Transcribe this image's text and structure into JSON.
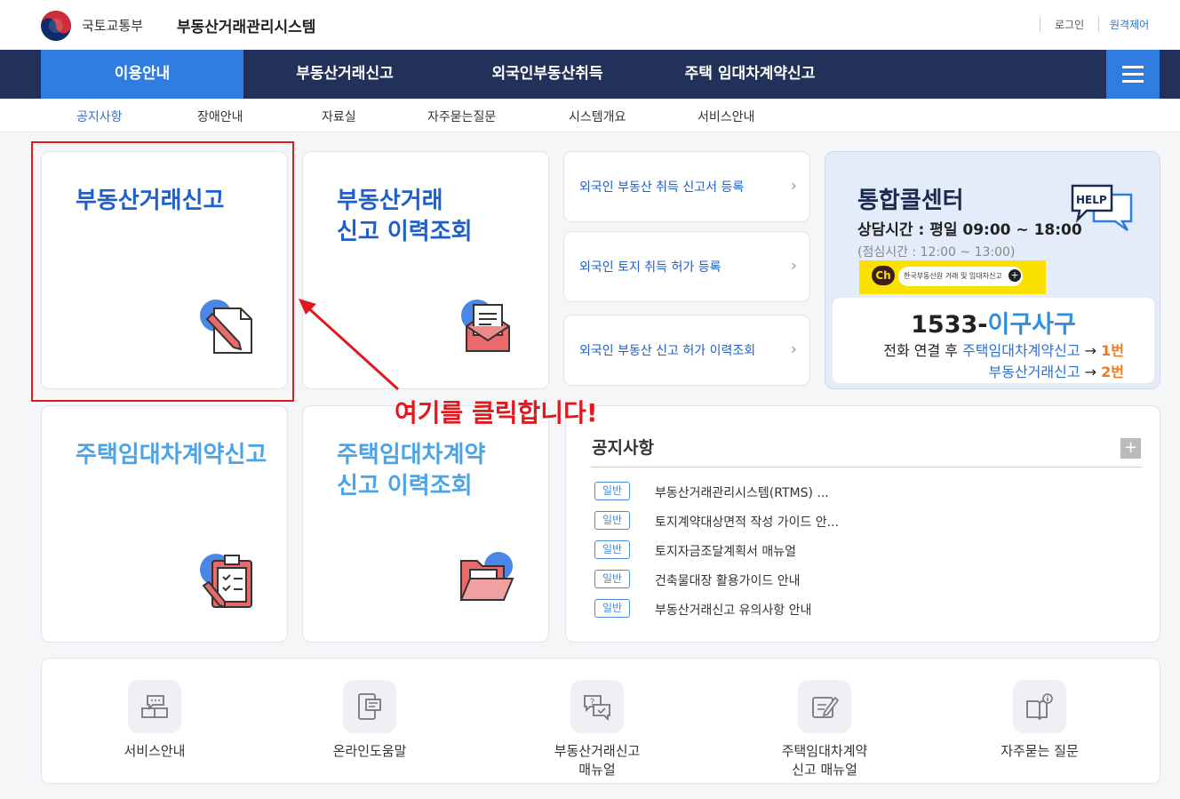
{
  "header": {
    "ministry": "국토교통부",
    "system_name": "부동산거래관리시스템",
    "login": "로그인",
    "remote": "원격제어"
  },
  "gnb": [
    "이용안내",
    "부동산거래신고",
    "외국인부동산취득",
    "주택 임대차계약신고"
  ],
  "snb": [
    "공지사항",
    "장애안내",
    "자료실",
    "자주묻는질문",
    "시스템개요",
    "서비스안내"
  ],
  "cards": {
    "trade_report": "부동산거래신고",
    "trade_history_1": "부동산거래",
    "trade_history_2": "신고 이력조회",
    "lease_report": "주택임대차계약신고",
    "lease_history_1": "주택임대차계약",
    "lease_history_2": "신고 이력조회"
  },
  "foreign_links": [
    "외국인 부동산 취득 신고서 등록",
    "외국인 토지 취득 허가 등록",
    "외국인 부동산 신고 허가 이력조회"
  ],
  "callcenter": {
    "title": "통합콜센터",
    "hours": "상담시간 : 평일 09:00 ~ 18:00",
    "lunch": "(점심시간 : 12:00 ~ 13:00)",
    "kakao_ch": "Ch",
    "kakao_label": "한국부동산원 거래 및 임대차신고",
    "phone_num": "1533-",
    "phone_word": "이구사구",
    "line1_pre": "전화 연결 후 ",
    "line1_hl": "주택임대차계약신고",
    "line1_arrow": " → ",
    "line1_no": "1번",
    "line2_hl": "부동산거래신고",
    "line2_arrow": " → ",
    "line2_no": "2번",
    "help": "HELP"
  },
  "notice": {
    "title": "공지사항",
    "plus": "+",
    "items": [
      {
        "badge": "일반",
        "text": "부동산거래관리시스템(RTMS) ..."
      },
      {
        "badge": "일반",
        "text": "토지계약대상면적 작성 가이드 안..."
      },
      {
        "badge": "일반",
        "text": "토지자금조달계획서 매뉴얼"
      },
      {
        "badge": "일반",
        "text": "건축물대장 활용가이드 안내"
      },
      {
        "badge": "일반",
        "text": "부동산거래신고 유의사항 안내"
      }
    ]
  },
  "quick": [
    "서비스안내",
    "온라인도움말",
    "부동산거래신고\n매뉴얼",
    "주택임대차계약\n신고 매뉴얼",
    "자주묻는 질문"
  ],
  "annotation": "여기를 클릭합니다!"
}
